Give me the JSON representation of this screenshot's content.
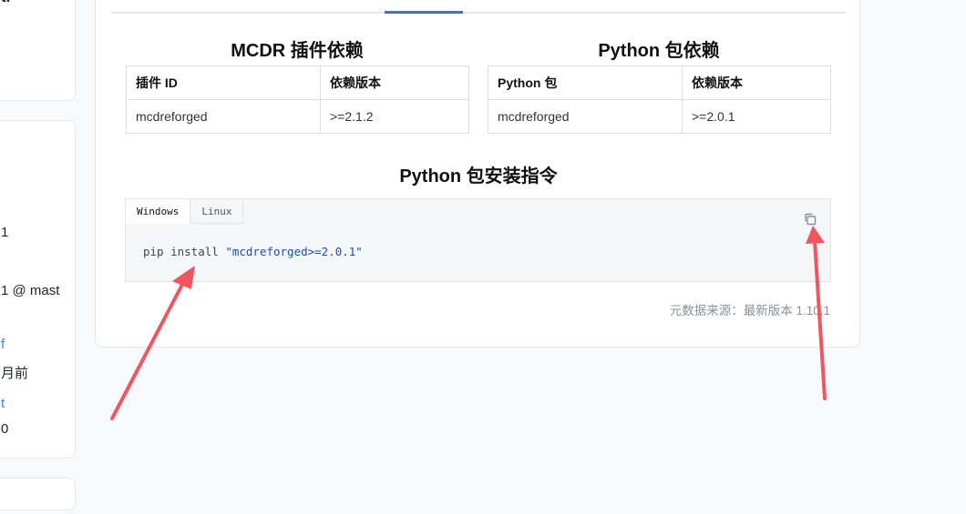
{
  "sidebar": {
    "card1_text": "ti",
    "card2": {
      "line1": "1",
      "line2": "1 @ mast",
      "line3": "f",
      "line4": "月前",
      "line5": "t",
      "line6": "0"
    }
  },
  "plugin_deps": {
    "title": "MCDR 插件依赖",
    "headers": [
      "插件 ID",
      "依赖版本"
    ],
    "rows": [
      [
        "mcdreforged",
        ">=2.1.2"
      ]
    ]
  },
  "python_deps": {
    "title": "Python 包依赖",
    "headers": [
      "Python 包",
      "依赖版本"
    ],
    "rows": [
      [
        "mcdreforged",
        ">=2.0.1"
      ]
    ]
  },
  "install": {
    "title": "Python 包安装指令",
    "tabs": [
      "Windows",
      "Linux"
    ],
    "active_tab": "Windows",
    "command_prefix": "pip install ",
    "command_arg": "\"mcdreforged>=2.0.1\""
  },
  "metadata_source": "元数据来源：最新版本 1.10.1",
  "colors": {
    "accent": "#4b6cc1",
    "annotation": "#f25560",
    "code_string": "#1f4fa0"
  }
}
